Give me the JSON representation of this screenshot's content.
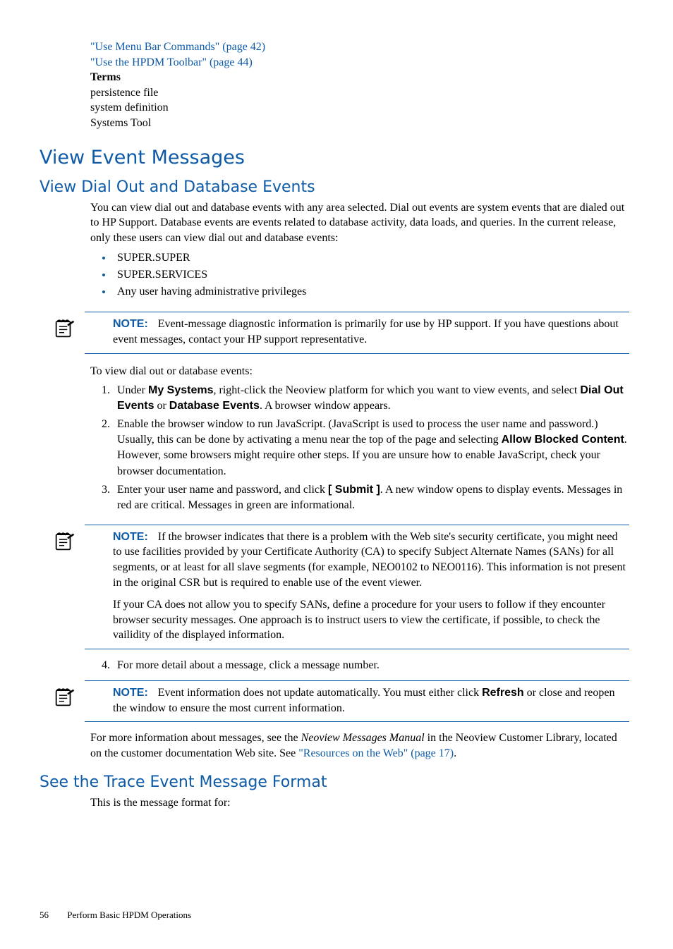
{
  "top_links": {
    "link1": "\"Use Menu Bar Commands\" (page 42)",
    "link2": "\"Use the HPDM Toolbar\" (page 44)",
    "terms_label": "Terms",
    "term1": "persistence file",
    "term2": "system definition",
    "term3": "Systems Tool"
  },
  "h1": "View Event Messages",
  "h2a": "View Dial Out and Database Events",
  "intro": "You can view dial out and database events with any area selected. Dial out events are system events that are dialed out to HP Support. Database events are events related to database activity, data loads, and queries. In the current release, only these users can view dial out and database events:",
  "bullets": {
    "b1": "SUPER.SUPER",
    "b2": "SUPER.SERVICES",
    "b3": "Any user having administrative privileges"
  },
  "note1": {
    "label": "NOTE:",
    "text": "Event-message diagnostic information is primarily for use by HP support. If you have questions about event messages, contact your HP support representative."
  },
  "lead_in": "To view dial out or database events:",
  "steps": {
    "s1a": "Under ",
    "s1b": "My Systems",
    "s1c": ", right-click the Neoview platform for which you want to view events, and select ",
    "s1d": "Dial Out Events",
    "s1e": " or ",
    "s1f": "Database Events",
    "s1g": ". A browser window appears.",
    "s2a": "Enable the browser window to run JavaScript. (JavaScript is used to process the user name and password.) Usually, this can be done by activating a menu near the top of the page and selecting ",
    "s2b": "Allow Blocked Content",
    "s2c": ". However, some browsers might require other steps. If you are unsure how to enable JavaScript, check your browser documentation.",
    "s3a": "Enter your user name and password, and click ",
    "s3b": "[ Submit ]",
    "s3c": ". A new window opens to display events. Messages in red are critical. Messages in green are informational."
  },
  "note2": {
    "label": "NOTE:",
    "p1": "If the browser indicates that there is a problem with the Web site's security certificate, you might need to use facilities provided by your Certificate Authority (CA) to specify Subject Alternate Names (SANs) for all segments, or at least for all slave segments (for example, NEO0102 to NEO0116). This information is not present in the original CSR but is required to enable use of the event viewer.",
    "p2": "If your CA does not allow you to specify SANs, define a procedure for your users to follow if they encounter browser security messages. One approach is to instruct users to view the certificate, if possible, to check the vailidity of the displayed information."
  },
  "step4": "For more detail about a message, click a message number.",
  "note3": {
    "label": "NOTE:",
    "t1": "Event information does not update automatically. You must either click ",
    "t2": "Refresh",
    "t3": " or close and reopen the window to ensure the most current information."
  },
  "moreinfo": {
    "a": "For more information about messages, see the ",
    "b": "Neoview Messages Manual",
    "c": " in the Neoview Customer Library, located on the customer documentation Web site. See ",
    "d": "\"Resources on the Web\" (page 17)",
    "e": "."
  },
  "h2b": "See the Trace Event Message Format",
  "tail": "This is the message format for:",
  "footer": {
    "page": "56",
    "title": "Perform Basic HPDM Operations"
  }
}
